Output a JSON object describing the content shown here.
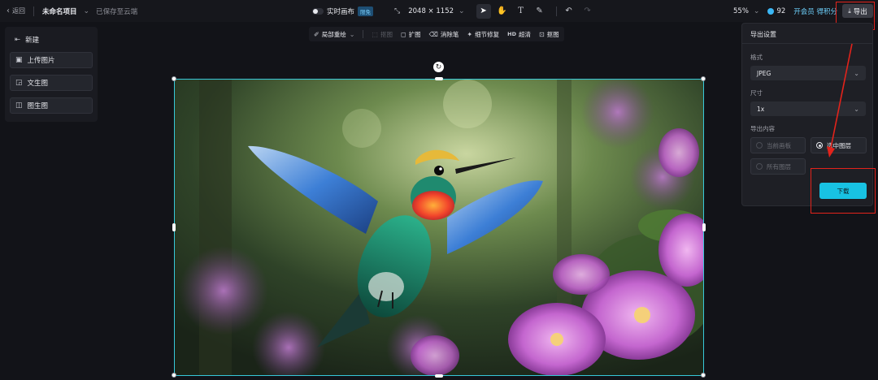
{
  "topbar": {
    "back_label": "返回",
    "project_title": "未命名项目",
    "saved_status": "已保存至云端",
    "realtime_label": "实时画布",
    "realtime_badge": "限免",
    "canvas_size": "2048 × 1152",
    "zoom": "55%",
    "credits": "92",
    "vip_link": "开会员 得积分",
    "export_label": "导出"
  },
  "left_panel": {
    "new_label": "新建",
    "items": [
      {
        "label": "上传图片",
        "icon": "image-upload-icon"
      },
      {
        "label": "文生图",
        "icon": "text-to-image-icon"
      },
      {
        "label": "图生图",
        "icon": "image-to-image-icon"
      }
    ]
  },
  "edit_toolbar": {
    "items": [
      {
        "label": "局部重绘",
        "icon": "brush-icon",
        "disabled": false
      },
      {
        "label": "抠图",
        "icon": "cutout-icon",
        "disabled": true
      },
      {
        "label": "扩图",
        "icon": "expand-icon",
        "disabled": false
      },
      {
        "label": "消除笔",
        "icon": "eraser-icon",
        "disabled": false
      },
      {
        "label": "细节修复",
        "icon": "repair-icon",
        "disabled": false
      },
      {
        "label": "超清",
        "icon": "hd-icon",
        "disabled": false
      },
      {
        "label": "抠图",
        "icon": "matting-icon",
        "disabled": false
      }
    ]
  },
  "export_panel": {
    "title": "导出设置",
    "format_label": "格式",
    "format_value": "JPEG",
    "size_label": "尺寸",
    "size_value": "1x",
    "content_label": "导出内容",
    "options": [
      {
        "label": "当前画板",
        "selected": false
      },
      {
        "label": "选中图层",
        "selected": true
      },
      {
        "label": "所有图层",
        "selected": false
      }
    ],
    "download_label": "下载"
  },
  "colors": {
    "accent": "#18c2e3",
    "selection": "#37c8d9",
    "annotation": "#e3231b",
    "background": "#121318"
  }
}
